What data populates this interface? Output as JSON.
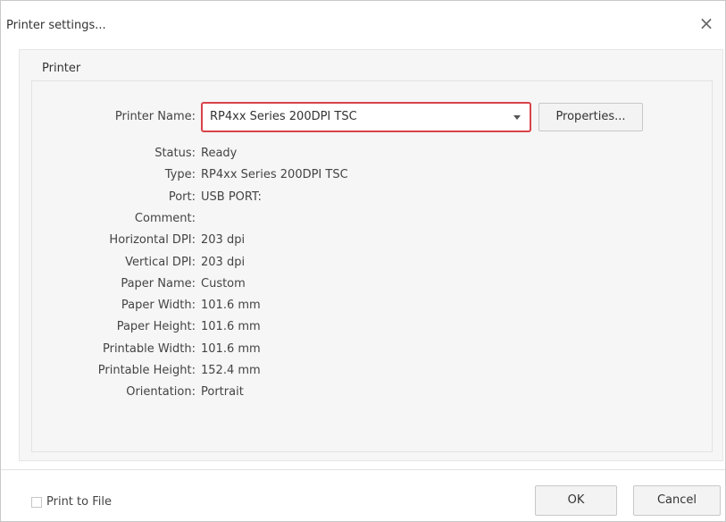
{
  "window": {
    "title": "Printer settings...",
    "close_glyph": "×"
  },
  "group": {
    "label": "Printer"
  },
  "printer_name": {
    "label": "Printer Name:",
    "selected": "RP4xx Series 200DPI TSC"
  },
  "properties_button": "Properties...",
  "details": [
    {
      "label": "Status:",
      "value": "Ready"
    },
    {
      "label": "Type:",
      "value": "RP4xx Series 200DPI TSC"
    },
    {
      "label": "Port:",
      "value": "USB PORT:"
    },
    {
      "label": "Comment:",
      "value": ""
    },
    {
      "label": "Horizontal DPI:",
      "value": "203 dpi"
    },
    {
      "label": "Vertical DPI:",
      "value": "203 dpi"
    },
    {
      "label": "Paper Name:",
      "value": "Custom"
    },
    {
      "label": "Paper Width:",
      "value": "101.6 mm"
    },
    {
      "label": "Paper Height:",
      "value": "101.6 mm"
    },
    {
      "label": "Printable Width:",
      "value": "101.6 mm"
    },
    {
      "label": "Printable Height:",
      "value": "152.4 mm"
    },
    {
      "label": "Orientation:",
      "value": "Portrait"
    }
  ],
  "footer": {
    "print_to_file_label": "Print to File",
    "print_to_file_checked": false,
    "ok_label": "OK",
    "cancel_label": "Cancel"
  },
  "colors": {
    "highlight_border": "#d9434a"
  },
  "icons": {
    "close": "close-icon",
    "dropdown": "chevron-down-icon"
  }
}
